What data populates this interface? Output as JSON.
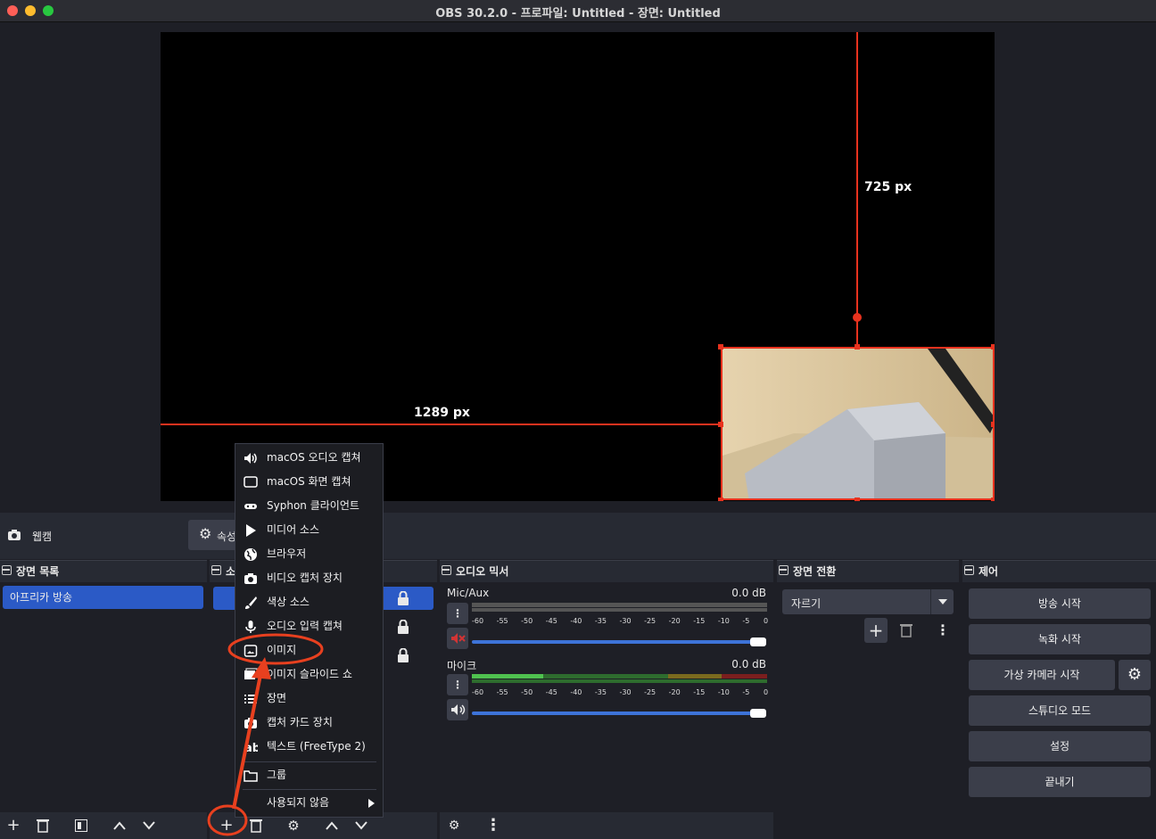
{
  "window": {
    "title": "OBS 30.2.0 - 프로파일: Untitled - 장면: Untitled"
  },
  "preview": {
    "horizontal_guide_label": "1289 px",
    "vertical_guide_label": "725 px"
  },
  "source_bar": {
    "source_name": "웹캠",
    "properties_label": "속성"
  },
  "scenes_dock": {
    "title": "장면 목록",
    "items": [
      "아프리카 방송"
    ]
  },
  "sources_dock": {
    "title_partial": "소"
  },
  "context_menu": {
    "items": [
      {
        "label": "macOS 오디오 캡쳐",
        "icon": "speaker-icon"
      },
      {
        "label": "macOS 화면 캡쳐",
        "icon": "monitor-icon"
      },
      {
        "label": "Syphon 클라이언트",
        "icon": "gamepad-icon"
      },
      {
        "label": "미디어 소스",
        "icon": "play-icon"
      },
      {
        "label": "브라우저",
        "icon": "globe-icon"
      },
      {
        "label": "비디오 캡처 장치",
        "icon": "camera-icon"
      },
      {
        "label": "색상 소스",
        "icon": "brush-icon"
      },
      {
        "label": "오디오 입력 캡쳐",
        "icon": "microphone-icon"
      },
      {
        "label": "이미지",
        "icon": "image-icon"
      },
      {
        "label": "이미지 슬라이드 쇼",
        "icon": "slideshow-icon"
      },
      {
        "label": "장면",
        "icon": "list-icon"
      },
      {
        "label": "캡처 카드 장치",
        "icon": "camera-icon"
      },
      {
        "label": "텍스트 (FreeType 2)",
        "icon": "text-icon"
      },
      {
        "label": "그룹",
        "icon": "folder-icon"
      },
      {
        "label": "사용되지 않음",
        "icon": "chevron-right-icon"
      }
    ]
  },
  "audio_mixer": {
    "title": "오디오 믹서",
    "channels": [
      {
        "name": "Mic/Aux",
        "db": "0.0 dB",
        "muted": true,
        "level": 0.0
      },
      {
        "name": "마이크",
        "db": "0.0 dB",
        "muted": false,
        "level": 0.4
      }
    ],
    "scale": [
      "-60",
      "-55",
      "-50",
      "-45",
      "-40",
      "-35",
      "-30",
      "-25",
      "-20",
      "-15",
      "-10",
      "-5",
      "0"
    ]
  },
  "transitions_dock": {
    "title": "장면 전환",
    "selected": "자르기"
  },
  "controls_dock": {
    "title": "제어",
    "buttons": {
      "start_streaming": "방송 시작",
      "start_recording": "녹화 시작",
      "start_virtual_camera": "가상 카메라 시작",
      "studio_mode": "스튜디오 모드",
      "settings": "설정",
      "exit": "끝내기"
    }
  },
  "annotation": {
    "color": "#e8401f"
  }
}
